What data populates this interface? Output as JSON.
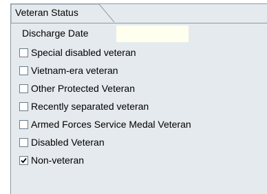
{
  "tab": {
    "label": "Veteran Status"
  },
  "discharge": {
    "label": "Discharge Date",
    "value": ""
  },
  "checkboxes": [
    {
      "label": "Special disabled veteran",
      "checked": false
    },
    {
      "label": "Vietnam-era veteran",
      "checked": false
    },
    {
      "label": "Other Protected Veteran",
      "checked": false
    },
    {
      "label": "Recently separated veteran",
      "checked": false
    },
    {
      "label": "Armed Forces Service Medal Veteran",
      "checked": false
    },
    {
      "label": "Disabled Veteran",
      "checked": false
    },
    {
      "label": "Non-veteran",
      "checked": true
    }
  ],
  "colors": {
    "panel_bg": "#e5eaee",
    "border": "#8a9aa6",
    "input_bg": "#fffff0"
  }
}
